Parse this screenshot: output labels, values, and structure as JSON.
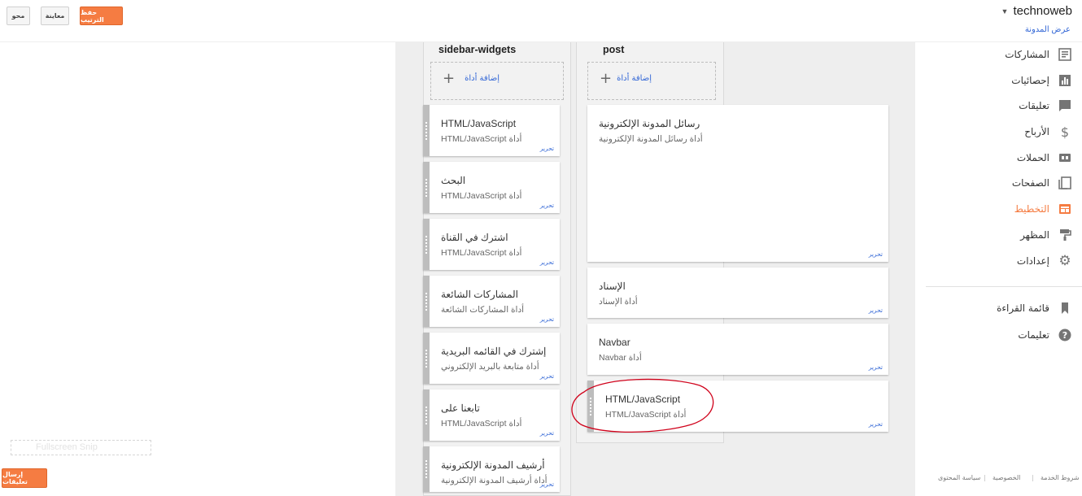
{
  "toolbar": {
    "clear_label": "محو",
    "preview_label": "معاينة",
    "save_label": "حفظ الترتيب"
  },
  "header": {
    "blog_name": "technoweb",
    "view_blog": "عرض المدونة"
  },
  "columns": {
    "sidebar": {
      "label": "sidebar-widgets",
      "add_label": "إضافة أداة",
      "widgets": [
        {
          "title": "HTML/JavaScript",
          "subtitle": "HTML/JavaScript أداة",
          "edit": "تحرير"
        },
        {
          "title": "البحث",
          "subtitle": "HTML/JavaScript أداة",
          "edit": "تحرير"
        },
        {
          "title": "اشترك في القناة",
          "subtitle": "HTML/JavaScript أداة",
          "edit": "تحرير"
        },
        {
          "title": "المشاركات الشائعة",
          "subtitle": "أداة المشاركات الشائعة",
          "edit": "تحرير"
        },
        {
          "title": "إشترك في القائمه البريدية",
          "subtitle": "أداة متابعة بالبريد الإلكتروني",
          "edit": "تحرير"
        },
        {
          "title": "تابعنا على",
          "subtitle": "HTML/JavaScript أداة",
          "edit": "تحرير"
        },
        {
          "title": "أرشيف المدونة الإلكترونية",
          "subtitle": "أداة أرشيف المدونة الإلكترونية",
          "edit": "تحرير"
        }
      ]
    },
    "post": {
      "label": "post",
      "add_label": "إضافة أداة",
      "widgets": [
        {
          "title": "رسائل المدونة الإلكترونية",
          "subtitle": "أداة رسائل المدونة الإلكترونية",
          "edit": "تحرير"
        },
        {
          "title": "الإسناد",
          "subtitle": "أداة الإسناد",
          "edit": "تحرير"
        },
        {
          "title": "Navbar",
          "subtitle": "Navbar أداة",
          "edit": "تحرير"
        },
        {
          "title": "HTML/JavaScript",
          "subtitle": "HTML/JavaScript أداة",
          "edit": "تحرير"
        }
      ]
    }
  },
  "sidebar_nav": {
    "items": [
      {
        "label": "المشاركات",
        "icon": "posts-icon"
      },
      {
        "label": "إحصائيات",
        "icon": "stats-icon"
      },
      {
        "label": "تعليقات",
        "icon": "comments-icon"
      },
      {
        "label": "الأرباح",
        "icon": "dollar-icon"
      },
      {
        "label": "الحملات",
        "icon": "campaigns-icon"
      },
      {
        "label": "الصفحات",
        "icon": "pages-icon"
      },
      {
        "label": "التخطيط",
        "icon": "layout-icon",
        "active": true
      },
      {
        "label": "المظهر",
        "icon": "paint-roller-icon"
      },
      {
        "label": "إعدادات",
        "icon": "gear-icon"
      },
      {
        "label": "قائمة القراءة",
        "icon": "bookmark-icon"
      },
      {
        "label": "تعليمات",
        "icon": "help-icon"
      }
    ]
  },
  "footer": {
    "terms": "شروط الخدمة",
    "privacy": "الخصوصية",
    "content_policy": "سياسة المحتوى",
    "send_feedback": "إرسال تعليقات",
    "fullscreen_snip": "Fullscreen Snip"
  },
  "colors": {
    "accent": "#f57c42",
    "link": "#3367d6",
    "annotation": "#d0021b"
  }
}
